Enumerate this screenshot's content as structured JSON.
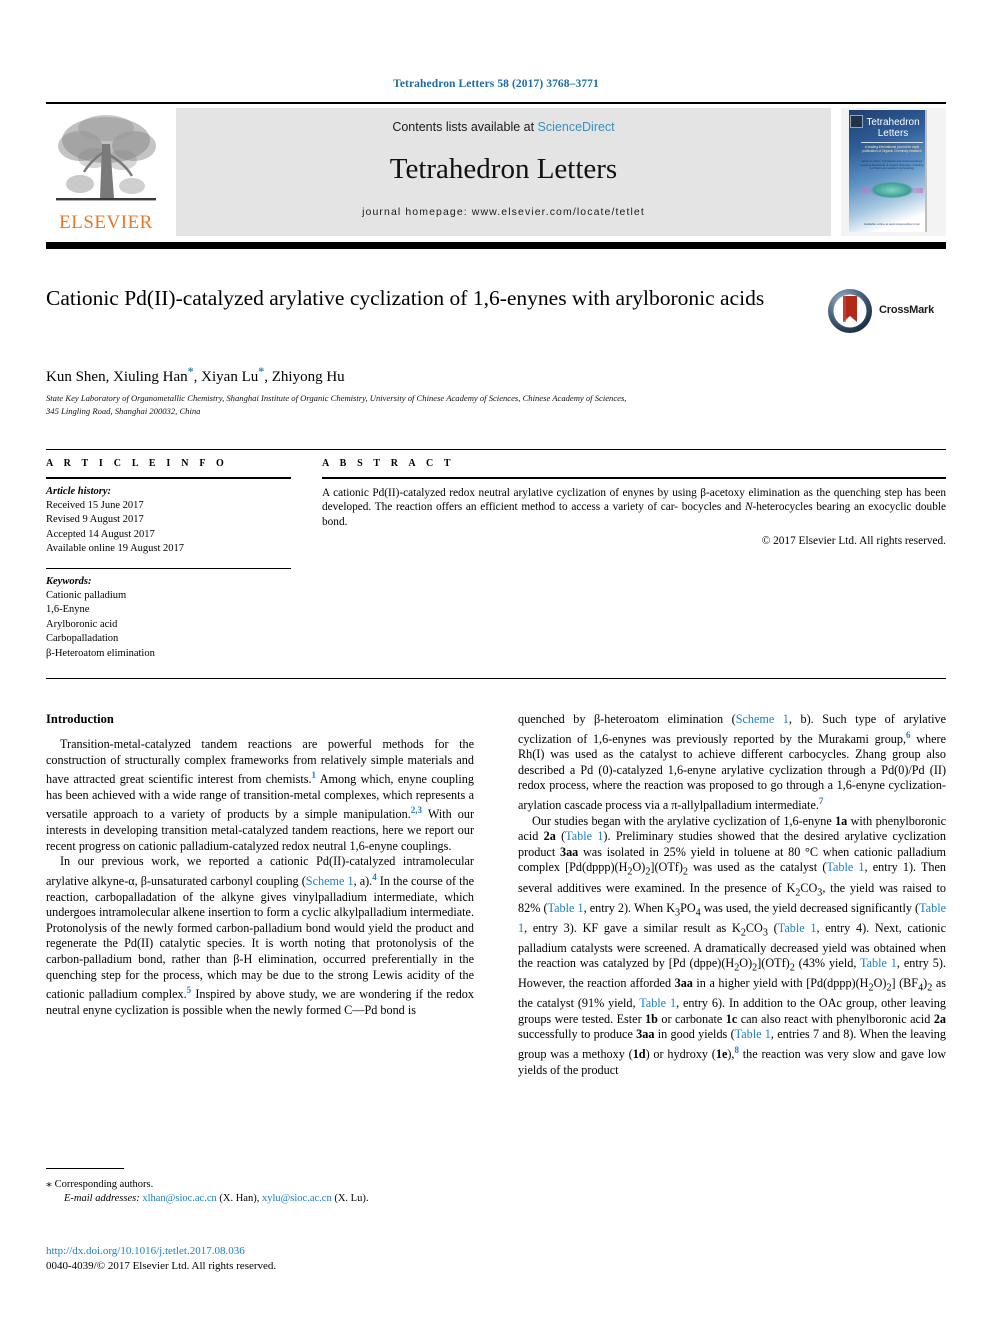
{
  "running_head": "Tetrahedron Letters 58 (2017) 3768–3771",
  "masthead": {
    "contents_prefix": "Contents lists available at ",
    "sciencedirect": "ScienceDirect",
    "journal_title": "Tetrahedron Letters",
    "homepage": "journal homepage: www.elsevier.com/locate/tetlet",
    "publisher": "ELSEVIER",
    "cover": {
      "title": "Tetrahedron Letters",
      "subtitle": "A leading international journal for rapid publication of Organic Chemistry research",
      "body": "Editor-in-Chief · Full papers and communications covering all aspects of organic chemistry, including synthesis and reaction methodology",
      "footer": "Available online at www.sciencedirect.com"
    }
  },
  "article": {
    "title": "Cationic Pd(II)-catalyzed arylative cyclization of 1,6-enynes with arylboronic acids",
    "authors_plain": "Kun Shen, Xiuling Han *, Xiyan Lu *, Zhiyong Hu",
    "authors": [
      {
        "name": "Kun Shen",
        "star": false
      },
      {
        "name": "Xiuling Han",
        "star": true
      },
      {
        "name": "Xiyan Lu",
        "star": true
      },
      {
        "name": "Zhiyong Hu",
        "star": false
      }
    ],
    "affiliation_line1": "State Key Laboratory of Organometallic Chemistry, Shanghai Institute of Organic Chemistry, University of Chinese Academy of Sciences, Chinese Academy of Sciences,",
    "affiliation_line2": "345 Lingling Road, Shanghai 200032, China",
    "crossmark_label": "CrossMark"
  },
  "article_info": {
    "heading": "A R T I C L E    I N F O",
    "history_label": "Article history:",
    "history": [
      "Received 15 June 2017",
      "Revised 9 August 2017",
      "Accepted 14 August 2017",
      "Available online 19 August 2017"
    ],
    "keywords_label": "Keywords:",
    "keywords": [
      "Cationic palladium",
      "1,6-Enyne",
      "Arylboronic acid",
      "Carbopalladation",
      "β-Heteroatom elimination"
    ]
  },
  "abstract": {
    "heading": "A B S T R A C T",
    "text": "A cationic Pd(II)-catalyzed redox neutral arylative cyclization of enynes by using β-acetoxy elimination as the quenching step has been developed. The reaction offers an efficient method to access a variety of carbocycles and N-heterocycles bearing an exocyclic double bond.",
    "copyright": "© 2017 Elsevier Ltd. All rights reserved."
  },
  "body": {
    "intro_heading": "Introduction",
    "left_paragraphs": [
      "Transition-metal-catalyzed tandem reactions are powerful methods for the construction of structurally complex frameworks from relatively simple materials and have attracted great scientific interest from chemists.1 Among which, enyne coupling has been achieved with a wide range of transition-metal complexes, which represents a versatile approach to a variety of products by a simple manipulation.2,3 With our interests in developing transition metal-catalyzed tandem reactions, here we report our recent progress on cationic palladium-catalyzed redox neutral 1,6-enyne couplings.",
      "In our previous work, we reported a cationic Pd(II)-catalyzed intramolecular arylative alkyne-α, β-unsaturated carbonyl coupling (Scheme 1, a).4 In the course of the reaction, carbopalladation of the alkyne gives vinylpalladium intermediate, which undergoes intramolecular alkene insertion to form a cyclic alkylpalladium intermediate. Protonolysis of the newly formed carbon-palladium bond would yield the product and regenerate the Pd(II) catalytic species. It is worth noting that protonolysis of the carbon-palladium bond, rather than β-H elimination, occurred preferentially in the quenching step for the process, which may be due to the strong Lewis acidity of the cationic palladium complex.5 Inspired by above study, we are wondering if the redox neutral enyne cyclization is possible when the newly formed C—Pd bond is"
    ],
    "right_paragraphs": [
      "quenched by β-heteroatom elimination (Scheme 1, b). Such type of arylative cyclization of 1,6-enynes was previously reported by the Murakami group,6 where Rh(I) was used as the catalyst to achieve different carbocycles. Zhang group also described a Pd (0)-catalyzed 1,6-enyne arylative cyclization through a Pd(0)/Pd (II) redox process, where the reaction was proposed to go through a 1,6-enyne cyclization-arylation cascade process via a π-allylpalladium intermediate.7",
      "Our studies began with the arylative cyclization of 1,6-enyne 1a with phenylboronic acid 2a (Table 1). Preliminary studies showed that the desired arylative cyclization product 3aa was isolated in 25% yield in toluene at 80 °C when cationic palladium complex [Pd(dppp)(H2O)2](OTf)2 was used as the catalyst (Table 1, entry 1). Then several additives were examined. In the presence of K2CO3, the yield was raised to 82% (Table 1, entry 2). When K3PO4 was used, the yield decreased significantly (Table 1, entry 3). KF gave a similar result as K2CO3 (Table 1, entry 4). Next, cationic palladium catalysts were screened. A dramatically decreased yield was obtained when the reaction was catalyzed by [Pd(dppe)(H2O)2](OTf)2 (43% yield, Table 1, entry 5). However, the reaction afforded 3aa in a higher yield with [Pd(dppp)(H2O)2](BF4)2 as the catalyst (91% yield, Table 1, entry 6). In addition to the OAc group, other leaving groups were tested. Ester 1b or carbonate 1c can also react with phenylboronic acid 2a successfully to produce 3aa in good yields (Table 1, entries 7 and 8). When the leaving group was a methoxy (1d) or hydroxy (1e),8 the reaction was very slow and gave low yields of the product"
    ]
  },
  "footnote": {
    "corresponding": "Corresponding authors.",
    "email_label": "E-mail addresses:",
    "email1": "xlhan@sioc.ac.cn",
    "email1_owner": "(X. Han)",
    "email2": "xylu@sioc.ac.cn",
    "email2_owner": "(X. Lu)."
  },
  "footer": {
    "doi": "http://dx.doi.org/10.1016/j.tetlet.2017.08.036",
    "issn_line": "0040-4039/© 2017 Elsevier Ltd. All rights reserved."
  },
  "colors": {
    "link": "#1a7fc1",
    "running_head": "#1a6ba8",
    "elsevier_orange": "#E87722",
    "masthead_bg": "#e4e4e4"
  }
}
